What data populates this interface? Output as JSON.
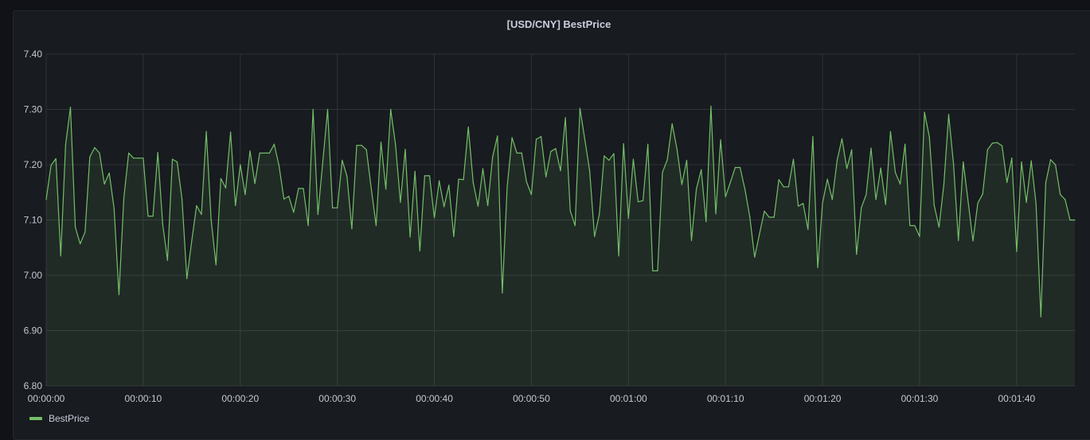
{
  "panel": {
    "title": "[USD/CNY] BestPrice"
  },
  "colors": {
    "series": "#73bf69",
    "grid": "#2f3237",
    "background": "#181b1f",
    "text": "#ccccdc"
  },
  "chart_data": {
    "type": "area",
    "title": "[USD/CNY] BestPrice",
    "xlabel": "",
    "ylabel": "",
    "xlim": [
      "00:00:00",
      "00:01:46"
    ],
    "ylim": [
      6.8,
      7.4
    ],
    "grid": true,
    "legend": "bottom-left",
    "x_ticks": [
      "00:00:00",
      "00:00:10",
      "00:00:20",
      "00:00:30",
      "00:00:40",
      "00:00:50",
      "00:01:00",
      "00:01:10",
      "00:01:20",
      "00:01:30",
      "00:01:40"
    ],
    "y_ticks": [
      "6.80",
      "6.90",
      "7.00",
      "7.10",
      "7.20",
      "7.30",
      "7.40"
    ],
    "series": [
      {
        "name": "BestPrice",
        "points": [
          [
            "00:00:00.0",
            7.137
          ],
          [
            "00:00:00.5",
            7.199
          ],
          [
            "00:00:01.0",
            7.211
          ],
          [
            "00:00:01.5",
            7.035
          ],
          [
            "00:00:02.0",
            7.236
          ],
          [
            "00:00:02.5",
            7.304
          ],
          [
            "00:00:03.0",
            7.087
          ],
          [
            "00:00:03.5",
            7.057
          ],
          [
            "00:00:04.0",
            7.078
          ],
          [
            "00:00:04.5",
            7.214
          ],
          [
            "00:00:05.0",
            7.231
          ],
          [
            "00:00:05.5",
            7.221
          ],
          [
            "00:00:06.0",
            7.165
          ],
          [
            "00:00:06.5",
            7.185
          ],
          [
            "00:00:07.0",
            7.121
          ],
          [
            "00:00:07.5",
            6.965
          ],
          [
            "00:00:08.0",
            7.139
          ],
          [
            "00:00:08.5",
            7.221
          ],
          [
            "00:00:09.0",
            7.212
          ],
          [
            "00:00:09.5",
            7.212
          ],
          [
            "00:00:10.0",
            7.212
          ],
          [
            "00:00:10.5",
            7.107
          ],
          [
            "00:00:11.0",
            7.107
          ],
          [
            "00:00:11.5",
            7.222
          ],
          [
            "00:00:12.0",
            7.093
          ],
          [
            "00:00:12.5",
            7.027
          ],
          [
            "00:00:13.0",
            7.21
          ],
          [
            "00:00:13.5",
            7.205
          ],
          [
            "00:00:14.0",
            7.138
          ],
          [
            "00:00:14.5",
            6.994
          ],
          [
            "00:00:15.0",
            7.062
          ],
          [
            "00:00:15.5",
            7.126
          ],
          [
            "00:00:16.0",
            7.11
          ],
          [
            "00:00:16.5",
            7.26
          ],
          [
            "00:00:17.0",
            7.1
          ],
          [
            "00:00:17.5",
            7.019
          ],
          [
            "00:00:18.0",
            7.175
          ],
          [
            "00:00:18.5",
            7.158
          ],
          [
            "00:00:19.0",
            7.259
          ],
          [
            "00:00:19.5",
            7.126
          ],
          [
            "00:00:20.0",
            7.2
          ],
          [
            "00:00:20.5",
            7.146
          ],
          [
            "00:00:21.0",
            7.225
          ],
          [
            "00:00:21.5",
            7.166
          ],
          [
            "00:00:22.0",
            7.221
          ],
          [
            "00:00:22.5",
            7.221
          ],
          [
            "00:00:23.0",
            7.221
          ],
          [
            "00:00:23.5",
            7.237
          ],
          [
            "00:00:24.0",
            7.198
          ],
          [
            "00:00:24.5",
            7.138
          ],
          [
            "00:00:25.0",
            7.143
          ],
          [
            "00:00:25.5",
            7.114
          ],
          [
            "00:00:26.0",
            7.157
          ],
          [
            "00:00:26.5",
            7.157
          ],
          [
            "00:00:27.0",
            7.09
          ],
          [
            "00:00:27.5",
            7.3
          ],
          [
            "00:00:28.0",
            7.11
          ],
          [
            "00:00:28.5",
            7.205
          ],
          [
            "00:00:29.0",
            7.3
          ],
          [
            "00:00:29.5",
            7.122
          ],
          [
            "00:00:30.0",
            7.122
          ],
          [
            "00:00:30.5",
            7.208
          ],
          [
            "00:00:31.0",
            7.179
          ],
          [
            "00:00:31.5",
            7.084
          ],
          [
            "00:00:32.0",
            7.235
          ],
          [
            "00:00:32.5",
            7.235
          ],
          [
            "00:00:33.0",
            7.227
          ],
          [
            "00:00:33.5",
            7.157
          ],
          [
            "00:00:34.0",
            7.09
          ],
          [
            "00:00:34.5",
            7.241
          ],
          [
            "00:00:35.0",
            7.156
          ],
          [
            "00:00:35.5",
            7.3
          ],
          [
            "00:00:36.0",
            7.236
          ],
          [
            "00:00:36.5",
            7.132
          ],
          [
            "00:00:37.0",
            7.228
          ],
          [
            "00:00:37.5",
            7.069
          ],
          [
            "00:00:38.0",
            7.188
          ],
          [
            "00:00:38.5",
            7.044
          ],
          [
            "00:00:39.0",
            7.18
          ],
          [
            "00:00:39.5",
            7.18
          ],
          [
            "00:00:40.0",
            7.104
          ],
          [
            "00:00:40.5",
            7.171
          ],
          [
            "00:00:41.0",
            7.124
          ],
          [
            "00:00:41.5",
            7.163
          ],
          [
            "00:00:42.0",
            7.07
          ],
          [
            "00:00:42.5",
            7.174
          ],
          [
            "00:00:43.0",
            7.173
          ],
          [
            "00:00:43.5",
            7.268
          ],
          [
            "00:00:44.0",
            7.168
          ],
          [
            "00:00:44.5",
            7.125
          ],
          [
            "00:00:45.0",
            7.193
          ],
          [
            "00:00:45.5",
            7.126
          ],
          [
            "00:00:46.0",
            7.214
          ],
          [
            "00:00:46.5",
            7.252
          ],
          [
            "00:00:47.0",
            6.968
          ],
          [
            "00:00:47.5",
            7.16
          ],
          [
            "00:00:48.0",
            7.249
          ],
          [
            "00:00:48.5",
            7.221
          ],
          [
            "00:00:49.0",
            7.221
          ],
          [
            "00:00:49.5",
            7.169
          ],
          [
            "00:00:50.0",
            7.146
          ],
          [
            "00:00:50.5",
            7.246
          ],
          [
            "00:00:51.0",
            7.251
          ],
          [
            "00:00:51.5",
            7.178
          ],
          [
            "00:00:52.0",
            7.224
          ],
          [
            "00:00:52.5",
            7.229
          ],
          [
            "00:00:53.0",
            7.189
          ],
          [
            "00:00:53.5",
            7.285
          ],
          [
            "00:00:54.0",
            7.117
          ],
          [
            "00:00:54.5",
            7.09
          ],
          [
            "00:00:55.0",
            7.302
          ],
          [
            "00:00:55.5",
            7.246
          ],
          [
            "00:00:56.0",
            7.189
          ],
          [
            "00:00:56.5",
            7.07
          ],
          [
            "00:00:57.0",
            7.111
          ],
          [
            "00:00:57.5",
            7.216
          ],
          [
            "00:00:58.0",
            7.208
          ],
          [
            "00:00:58.5",
            7.22
          ],
          [
            "00:00:59.0",
            7.035
          ],
          [
            "00:00:59.5",
            7.238
          ],
          [
            "00:01:00.0",
            7.103
          ],
          [
            "00:01:00.5",
            7.21
          ],
          [
            "00:01:01.0",
            7.133
          ],
          [
            "00:01:01.5",
            7.135
          ],
          [
            "00:01:02.0",
            7.237
          ],
          [
            "00:01:02.5",
            7.008
          ],
          [
            "00:01:03.0",
            7.008
          ],
          [
            "00:01:03.5",
            7.186
          ],
          [
            "00:01:04.0",
            7.209
          ],
          [
            "00:01:04.5",
            7.274
          ],
          [
            "00:01:05.0",
            7.228
          ],
          [
            "00:01:05.5",
            7.164
          ],
          [
            "00:01:06.0",
            7.208
          ],
          [
            "00:01:06.5",
            7.063
          ],
          [
            "00:01:07.0",
            7.156
          ],
          [
            "00:01:07.5",
            7.191
          ],
          [
            "00:01:08.0",
            7.097
          ],
          [
            "00:01:08.5",
            7.306
          ],
          [
            "00:01:09.0",
            7.111
          ],
          [
            "00:01:09.5",
            7.245
          ],
          [
            "00:01:10.0",
            7.142
          ],
          [
            "00:01:10.5",
            7.168
          ],
          [
            "00:01:11.0",
            7.195
          ],
          [
            "00:01:11.5",
            7.195
          ],
          [
            "00:01:12.0",
            7.156
          ],
          [
            "00:01:12.5",
            7.106
          ],
          [
            "00:01:13.0",
            7.033
          ],
          [
            "00:01:13.5",
            7.075
          ],
          [
            "00:01:14.0",
            7.116
          ],
          [
            "00:01:14.5",
            7.105
          ],
          [
            "00:01:15.0",
            7.105
          ],
          [
            "00:01:15.5",
            7.173
          ],
          [
            "00:01:16.0",
            7.16
          ],
          [
            "00:01:16.5",
            7.16
          ],
          [
            "00:01:17.0",
            7.21
          ],
          [
            "00:01:17.5",
            7.125
          ],
          [
            "00:01:18.0",
            7.13
          ],
          [
            "00:01:18.5",
            7.083
          ],
          [
            "00:01:19.0",
            7.251
          ],
          [
            "00:01:19.5",
            7.014
          ],
          [
            "00:01:20.0",
            7.131
          ],
          [
            "00:01:20.5",
            7.174
          ],
          [
            "00:01:21.0",
            7.137
          ],
          [
            "00:01:21.5",
            7.208
          ],
          [
            "00:01:22.0",
            7.247
          ],
          [
            "00:01:22.5",
            7.193
          ],
          [
            "00:01:23.0",
            7.227
          ],
          [
            "00:01:23.5",
            7.038
          ],
          [
            "00:01:24.0",
            7.122
          ],
          [
            "00:01:24.5",
            7.146
          ],
          [
            "00:01:25.0",
            7.23
          ],
          [
            "00:01:25.5",
            7.137
          ],
          [
            "00:01:26.0",
            7.194
          ],
          [
            "00:01:26.5",
            7.128
          ],
          [
            "00:01:27.0",
            7.26
          ],
          [
            "00:01:27.5",
            7.186
          ],
          [
            "00:01:28.0",
            7.165
          ],
          [
            "00:01:28.5",
            7.237
          ],
          [
            "00:01:29.0",
            7.09
          ],
          [
            "00:01:29.5",
            7.09
          ],
          [
            "00:01:30.0",
            7.07
          ],
          [
            "00:01:30.5",
            7.295
          ],
          [
            "00:01:31.0",
            7.251
          ],
          [
            "00:01:31.5",
            7.127
          ],
          [
            "00:01:32.0",
            7.087
          ],
          [
            "00:01:32.5",
            7.165
          ],
          [
            "00:01:33.0",
            7.291
          ],
          [
            "00:01:33.5",
            7.201
          ],
          [
            "00:01:34.0",
            7.063
          ],
          [
            "00:01:34.5",
            7.205
          ],
          [
            "00:01:35.0",
            7.134
          ],
          [
            "00:01:35.5",
            7.062
          ],
          [
            "00:01:36.0",
            7.131
          ],
          [
            "00:01:36.5",
            7.147
          ],
          [
            "00:01:37.0",
            7.227
          ],
          [
            "00:01:37.5",
            7.239
          ],
          [
            "00:01:38.0",
            7.24
          ],
          [
            "00:01:38.5",
            7.234
          ],
          [
            "00:01:39.0",
            7.168
          ],
          [
            "00:01:39.5",
            7.212
          ],
          [
            "00:01:40.0",
            7.043
          ],
          [
            "00:01:40.5",
            7.205
          ],
          [
            "00:01:41.0",
            7.132
          ],
          [
            "00:01:41.5",
            7.207
          ],
          [
            "00:01:42.0",
            7.13
          ],
          [
            "00:01:42.5",
            6.925
          ],
          [
            "00:01:43.0",
            7.167
          ],
          [
            "00:01:43.5",
            7.209
          ],
          [
            "00:01:44.0",
            7.2
          ],
          [
            "00:01:44.5",
            7.146
          ],
          [
            "00:01:45.0",
            7.137
          ],
          [
            "00:01:45.5",
            7.1
          ],
          [
            "00:01:46.0",
            7.1
          ]
        ]
      }
    ]
  },
  "legend": {
    "items": [
      {
        "label": "BestPrice"
      }
    ]
  }
}
